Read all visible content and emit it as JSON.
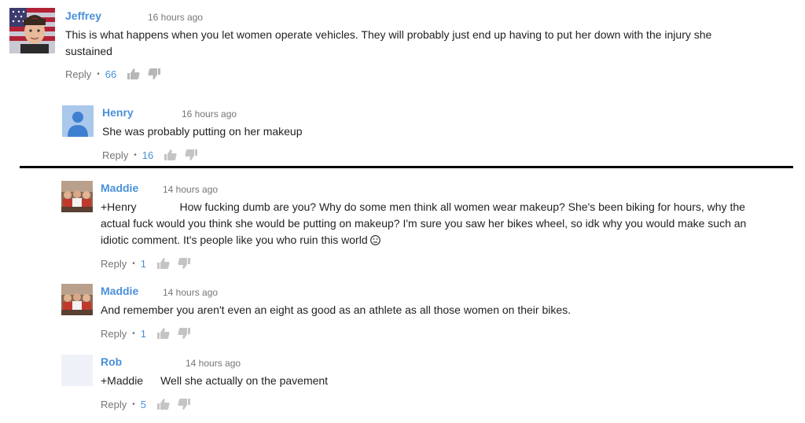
{
  "comments": [
    {
      "author": "Jeffrey",
      "time": "16 hours ago",
      "text": "This is what happens when you let women operate vehicles. They will probably just end up having to put her down with the injury she sustained",
      "reply_label": "Reply",
      "separator": "•",
      "likes": "66"
    },
    {
      "author": "Henry",
      "time": "16 hours ago",
      "text": "She was probably putting on her makeup",
      "reply_label": "Reply",
      "separator": "•",
      "likes": "16"
    },
    {
      "author": "Maddie",
      "time": "14 hours ago",
      "mention": "+Henry",
      "text": "How fucking dumb are you? Why do some men think all women wear makeup? She's been biking for hours, why the actual fuck would you think she would be putting on makeup? I'm sure you saw her bikes wheel, so idk why you would make such an idiotic comment. It's people like you who ruin this world",
      "emoji": "unamused-face-emoji",
      "reply_label": "Reply",
      "separator": "•",
      "likes": "1"
    },
    {
      "author": "Maddie",
      "time": "14 hours ago",
      "text": "And remember you aren't even an eight as good as an athlete as all those women on their bikes.",
      "reply_label": "Reply",
      "separator": "•",
      "likes": "1"
    },
    {
      "author": "Rob",
      "time": "14 hours ago",
      "mention": "+Maddie",
      "text": "Well she actually on the pavement",
      "reply_label": "Reply",
      "separator": "•",
      "likes": "5"
    }
  ],
  "icons": {
    "like": "thumbs-up-icon",
    "dislike": "thumbs-down-icon"
  },
  "colors": {
    "author": "#4a90d9",
    "likes": "#4a90d9",
    "meta": "#767676",
    "text": "#222222",
    "divider": "#000000"
  }
}
